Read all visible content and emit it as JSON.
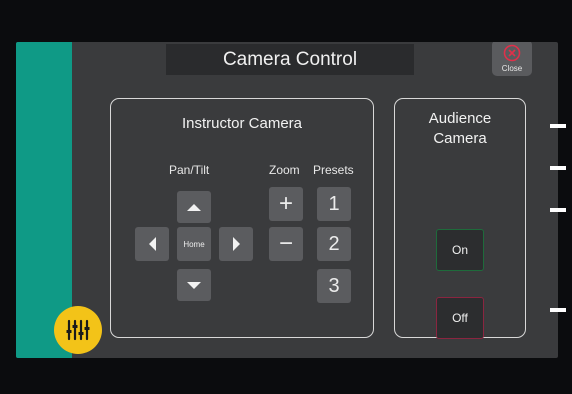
{
  "header": {
    "title": "Camera Control",
    "close_label": "Close"
  },
  "instructor": {
    "title": "Instructor Camera",
    "pan_tilt_label": "Pan/Tilt",
    "zoom_label": "Zoom",
    "presets_label": "Presets",
    "home_label": "Home",
    "zoom_in_label": "+",
    "zoom_out_label": "−",
    "presets": [
      "1",
      "2",
      "3"
    ]
  },
  "audience": {
    "title_line1": "Audience",
    "title_line2": "Camera",
    "on_label": "On",
    "off_label": "Off"
  },
  "colors": {
    "accent_teal": "#0f9a86",
    "fab_yellow": "#f3c318",
    "close_red": "#e0304a",
    "on_border": "#1e6b3b",
    "off_border": "#8a2540"
  },
  "icons": {
    "close": "close-circle-icon",
    "fab": "audio-mixer-icon"
  }
}
